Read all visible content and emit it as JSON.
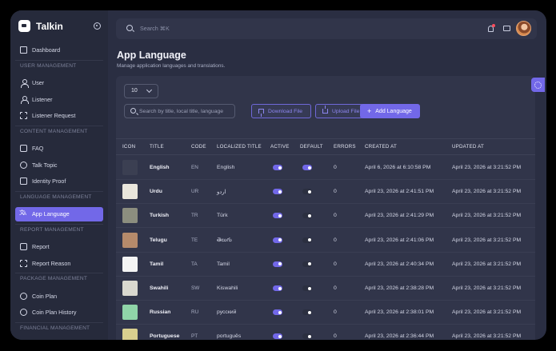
{
  "app": {
    "name": "Talkin"
  },
  "sidebar": {
    "items": [
      {
        "label": "Dashboard",
        "icon": "home-icon"
      },
      {
        "section": "USER MANAGEMENT"
      },
      {
        "label": "User",
        "icon": "user-icon"
      },
      {
        "label": "Listener",
        "icon": "user-icon"
      },
      {
        "label": "Listener Request",
        "icon": "request-icon"
      },
      {
        "section": "CONTENT MANAGEMENT"
      },
      {
        "label": "FAQ",
        "icon": "faq-icon"
      },
      {
        "label": "Talk Topic",
        "icon": "chat-icon"
      },
      {
        "label": "Identity Proof",
        "icon": "id-card-icon"
      },
      {
        "section": "LANGUAGE MANAGEMENT"
      },
      {
        "label": "App Language",
        "icon": "language-icon",
        "active": true
      },
      {
        "section": "REPORT MANAGEMENT"
      },
      {
        "label": "Report",
        "icon": "report-icon"
      },
      {
        "label": "Report Reason",
        "icon": "report-reason-icon"
      },
      {
        "section": "PACKAGE MANAGEMENT"
      },
      {
        "label": "Coin Plan",
        "icon": "coin-icon"
      },
      {
        "label": "Coin Plan History",
        "icon": "history-icon"
      },
      {
        "section": "FINANCIAL MANAGEMENT"
      }
    ]
  },
  "topbar": {
    "search_placeholder": "Search ⌘K"
  },
  "page": {
    "title": "App Language",
    "subtitle": "Manage application languages and translations."
  },
  "toolbar": {
    "page_size": "10",
    "search_placeholder": "Search by title, local title, language",
    "download_label": "Download File",
    "upload_label": "Upload File",
    "add_label": "Add Language"
  },
  "table": {
    "columns": [
      "ICON",
      "TITLE",
      "CODE",
      "LOCALIZED TITLE",
      "ACTIVE",
      "DEFAULT",
      "ERRORS",
      "CREATED AT",
      "UPDATED AT"
    ],
    "rows": [
      {
        "icon_color": "#3b3f52",
        "title": "English",
        "code": "EN",
        "localized": "English",
        "active": true,
        "default": true,
        "errors": "0",
        "created": "April 6, 2026 at 6:10:58 PM",
        "updated": "April 23, 2026 at 3:21:52 PM"
      },
      {
        "icon_color": "#e9e6dc",
        "title": "Urdu",
        "code": "UR",
        "localized": "اردو",
        "active": true,
        "default": false,
        "errors": "0",
        "created": "April 23, 2026 at 2:41:51 PM",
        "updated": "April 23, 2026 at 3:21:52 PM"
      },
      {
        "icon_color": "#8c8e7f",
        "title": "Turkish",
        "code": "TR",
        "localized": "Türk",
        "active": true,
        "default": false,
        "errors": "0",
        "created": "April 23, 2026 at 2:41:29 PM",
        "updated": "April 23, 2026 at 3:21:52 PM"
      },
      {
        "icon_color": "#b58a6b",
        "title": "Telugu",
        "code": "TE",
        "localized": "తెలుగు",
        "active": true,
        "default": false,
        "errors": "0",
        "created": "April 23, 2026 at 2:41:06 PM",
        "updated": "April 23, 2026 at 3:21:52 PM"
      },
      {
        "icon_color": "#f4f4f4",
        "title": "Tamil",
        "code": "TA",
        "localized": "Tamil",
        "active": true,
        "default": false,
        "errors": "0",
        "created": "April 23, 2026 at 2:40:34 PM",
        "updated": "April 23, 2026 at 3:21:52 PM"
      },
      {
        "icon_color": "#d9d8cf",
        "title": "Swahili",
        "code": "SW",
        "localized": "Kiswahili",
        "active": true,
        "default": false,
        "errors": "0",
        "created": "April 23, 2026 at 2:38:28 PM",
        "updated": "April 23, 2026 at 3:21:52 PM"
      },
      {
        "icon_color": "#8fd4a8",
        "title": "Russian",
        "code": "RU",
        "localized": "русский",
        "active": true,
        "default": false,
        "errors": "0",
        "created": "April 23, 2026 at 2:38:01 PM",
        "updated": "April 23, 2026 at 3:21:52 PM"
      },
      {
        "icon_color": "#d8cf8f",
        "title": "Portuguese",
        "code": "PT",
        "localized": "português",
        "active": true,
        "default": false,
        "errors": "0",
        "created": "April 23, 2026 at 2:36:44 PM",
        "updated": "April 23, 2026 at 3:21:52 PM"
      }
    ]
  },
  "colors": {
    "accent": "#7268e8",
    "background": "#2a2e42",
    "sidebar": "#262a3b",
    "card": "#31354a"
  }
}
